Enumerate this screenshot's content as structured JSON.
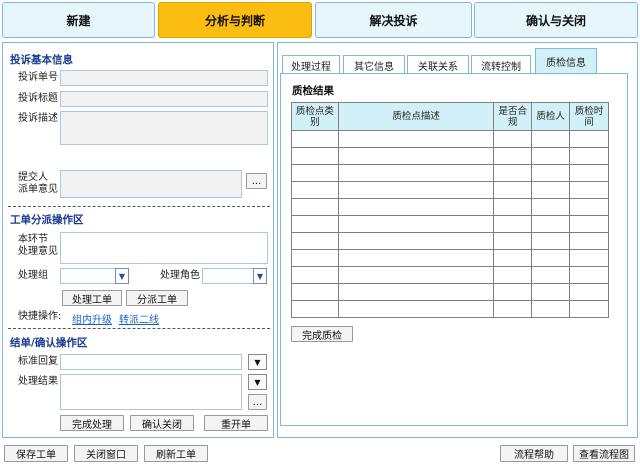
{
  "steps": [
    {
      "label": "新建",
      "active": false
    },
    {
      "label": "分析与判断",
      "active": true
    },
    {
      "label": "解决投诉",
      "active": false
    },
    {
      "label": "确认与关闭",
      "active": false
    }
  ],
  "complaint_info": {
    "title": "投诉基本信息",
    "number_label": "投诉单号",
    "subject_label": "投诉标题",
    "desc_label": "投诉描述",
    "submitter_label_1": "提交人",
    "submitter_label_2": "派单意见",
    "more_btn": "..."
  },
  "dispatch": {
    "title": "工单分派操作区",
    "opinion_label_1": "本环节",
    "opinion_label_2": "处理意见",
    "group_label": "处理组",
    "role_label": "处理角色",
    "process_btn": "处理工单",
    "dispatch_btn": "分派工单",
    "quick_label": "快捷操作:",
    "quick_links": [
      "组内升级",
      "转派二线"
    ]
  },
  "closing": {
    "title": "结单/确认操作区",
    "std_reply_label": "标准回复",
    "result_label": "处理结果",
    "more_btn": "...",
    "complete_btn": "完成处理",
    "confirm_btn": "确认关闭",
    "reopen_btn": "重开单"
  },
  "right_tabs": [
    {
      "label": "处理过程",
      "active": false
    },
    {
      "label": "其它信息",
      "active": false
    },
    {
      "label": "关联关系",
      "active": false
    },
    {
      "label": "流转控制",
      "active": false
    },
    {
      "label": "质检信息",
      "active": true
    }
  ],
  "qc": {
    "title": "质检结果",
    "headers": [
      "质检点类别",
      "质检点描述",
      "是否合规",
      "质检人",
      "质检时间"
    ],
    "complete_btn": "完成质检"
  },
  "footer": {
    "save": "保存工单",
    "close": "关闭窗口",
    "refresh": "刷新工单",
    "help": "流程帮助",
    "flowchart": "查看流程图"
  },
  "icons": {
    "dropdown": "triangle-down-icon"
  }
}
